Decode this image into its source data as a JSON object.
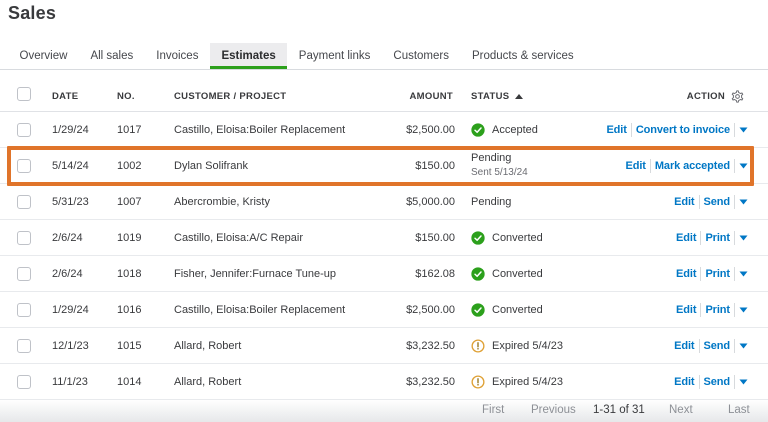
{
  "page_title": "Sales",
  "tabs": [
    {
      "label": "Overview",
      "active": false
    },
    {
      "label": "All sales",
      "active": false
    },
    {
      "label": "Invoices",
      "active": false
    },
    {
      "label": "Estimates",
      "active": true
    },
    {
      "label": "Payment links",
      "active": false
    },
    {
      "label": "Customers",
      "active": false
    },
    {
      "label": "Products & services",
      "active": false
    }
  ],
  "table": {
    "headers": {
      "date": "DATE",
      "no": "NO.",
      "customer": "CUSTOMER / PROJECT",
      "amount": "AMOUNT",
      "status": "STATUS",
      "action": "ACTION"
    },
    "rows": [
      {
        "date": "1/29/24",
        "no": "1017",
        "customer": "Castillo, Eloisa:Boiler Replacement",
        "amount": "$2,500.00",
        "status": "Accepted",
        "status_sub": "",
        "status_icon": "check",
        "actions": [
          "Edit",
          "Convert to invoice"
        ],
        "highlighted": false
      },
      {
        "date": "5/14/24",
        "no": "1002",
        "customer": "Dylan Solifrank",
        "amount": "$150.00",
        "status": "Pending",
        "status_sub": "Sent 5/13/24",
        "status_icon": "none",
        "actions": [
          "Edit",
          "Mark accepted"
        ],
        "highlighted": true
      },
      {
        "date": "5/31/23",
        "no": "1007",
        "customer": "Abercrombie, Kristy",
        "amount": "$5,000.00",
        "status": "Pending",
        "status_sub": "",
        "status_icon": "none",
        "actions": [
          "Edit",
          "Send"
        ],
        "highlighted": false
      },
      {
        "date": "2/6/24",
        "no": "1019",
        "customer": "Castillo, Eloisa:A/C Repair",
        "amount": "$150.00",
        "status": "Converted",
        "status_sub": "",
        "status_icon": "check",
        "actions": [
          "Edit",
          "Print"
        ],
        "highlighted": false
      },
      {
        "date": "2/6/24",
        "no": "1018",
        "customer": "Fisher, Jennifer:Furnace Tune-up",
        "amount": "$162.08",
        "status": "Converted",
        "status_sub": "",
        "status_icon": "check",
        "actions": [
          "Edit",
          "Print"
        ],
        "highlighted": false
      },
      {
        "date": "1/29/24",
        "no": "1016",
        "customer": "Castillo, Eloisa:Boiler Replacement",
        "amount": "$2,500.00",
        "status": "Converted",
        "status_sub": "",
        "status_icon": "check",
        "actions": [
          "Edit",
          "Print"
        ],
        "highlighted": false
      },
      {
        "date": "12/1/23",
        "no": "1015",
        "customer": "Allard, Robert",
        "amount": "$3,232.50",
        "status": "Expired 5/4/23",
        "status_sub": "",
        "status_icon": "warning",
        "actions": [
          "Edit",
          "Send"
        ],
        "highlighted": false
      },
      {
        "date": "11/1/23",
        "no": "1014",
        "customer": "Allard, Robert",
        "amount": "$3,232.50",
        "status": "Expired 5/4/23",
        "status_sub": "",
        "status_icon": "warning",
        "actions": [
          "Edit",
          "Send"
        ],
        "highlighted": false
      }
    ]
  },
  "pagination": {
    "first": "First",
    "previous": "Previous",
    "range": "1-31 of 31",
    "next": "Next",
    "last": "Last"
  },
  "colors": {
    "accent_green": "#2ca01c",
    "link_blue": "#0077c5",
    "highlight_orange": "#e0742a",
    "warning_amber": "#dfa136",
    "text_dark": "#393a3d",
    "text_gray": "#6b6c72"
  }
}
